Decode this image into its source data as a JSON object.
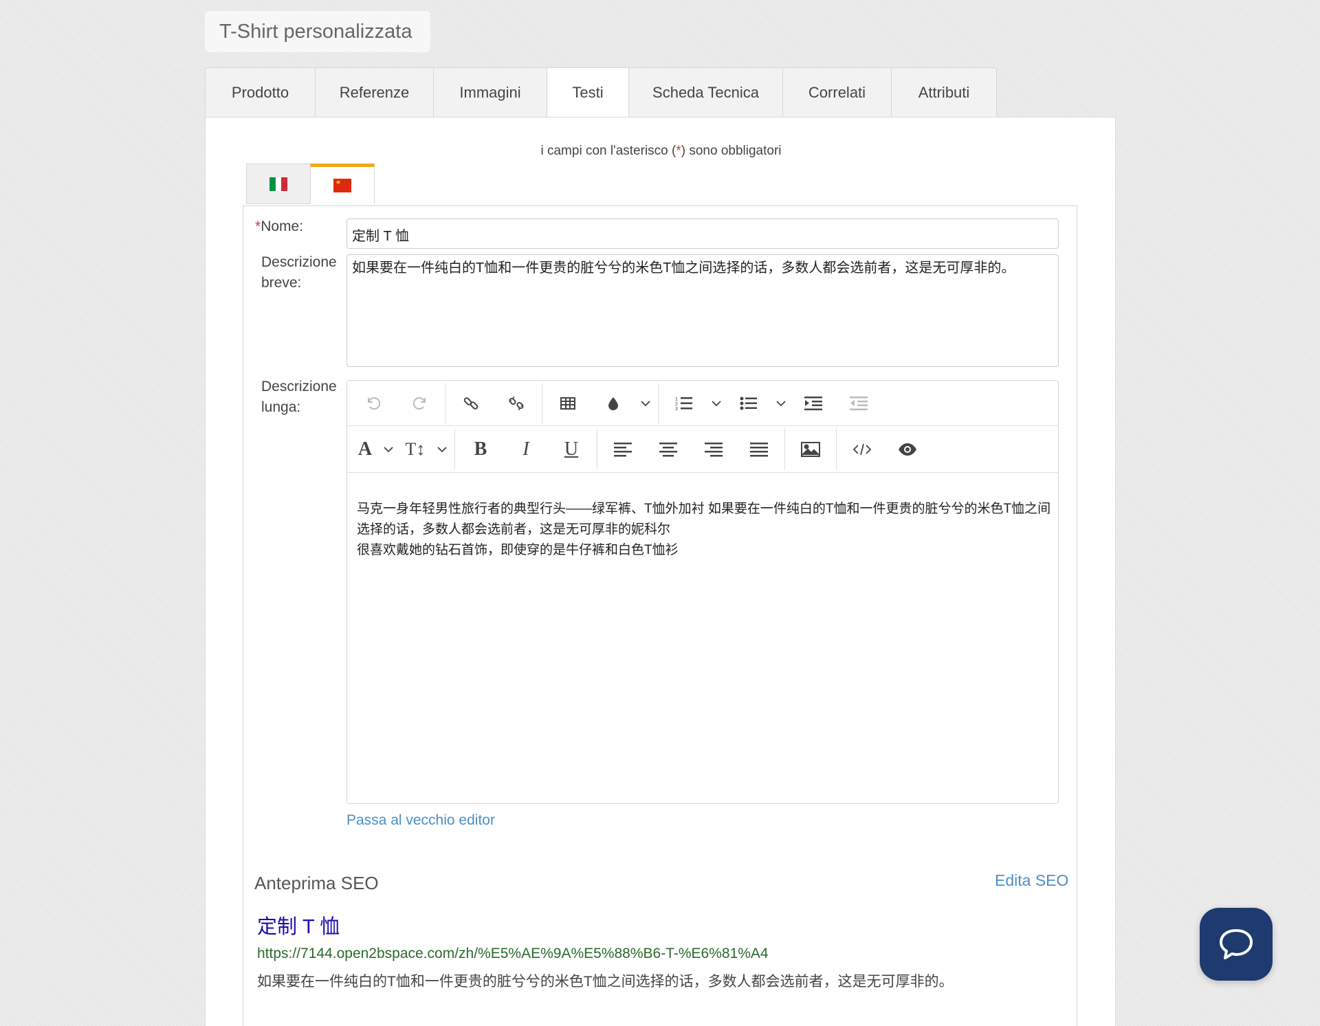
{
  "page_title": "T-Shirt personalizzata",
  "tabs": [
    {
      "label": "Prodotto",
      "width": 160
    },
    {
      "label": "Referenze",
      "width": 172
    },
    {
      "label": "Immagini",
      "width": 165
    },
    {
      "label": "Testi",
      "width": 119,
      "active": true
    },
    {
      "label": "Scheda Tecnica",
      "width": 224
    },
    {
      "label": "Correlati",
      "width": 158
    },
    {
      "label": "Attributi",
      "width": 154
    }
  ],
  "required_note": {
    "before": "i campi con l'asterisco (",
    "star": "*",
    "after": ") sono obbligatori"
  },
  "languages": [
    {
      "code": "it",
      "icon": "italy-flag-icon"
    },
    {
      "code": "zh",
      "icon": "china-flag-icon",
      "active": true
    }
  ],
  "form": {
    "name_label_star": "*",
    "name_label": "Nome:",
    "name_value": "定制 T 恤",
    "short_desc_label_1": "Descrizione",
    "short_desc_label_2": "breve:",
    "short_desc_value": "如果要在一件纯白的T恤和一件更贵的脏兮兮的米色T恤之间选择的话，多数人都会选前者，这是无可厚非的。",
    "long_desc_label_1": "Descrizione",
    "long_desc_label_2": "lunga:",
    "long_desc_line_1": "马克一身年轻男性旅行者的典型行头——绿军裤、T恤外加衬 如果要在一件纯白的T恤和一件更贵的脏兮兮的米色T恤之间选择的话，多数人都会选前者，这是无可厚非的妮科尔",
    "long_desc_line_2": "很喜欢戴她的钻石首饰，即使穿的是牛仔裤和白色T恤衫",
    "old_editor_link": "Passa al vecchio editor"
  },
  "toolbar": {
    "row1": [
      "undo-icon",
      "redo-icon",
      "link-icon",
      "unlink-icon",
      "table-icon",
      "color-drop-icon",
      "ordered-list-icon",
      "unordered-list-icon",
      "indent-icon",
      "outdent-icon"
    ],
    "row2": [
      "font-color-icon",
      "font-size-icon",
      "bold-icon",
      "italic-icon",
      "underline-icon",
      "align-left-icon",
      "align-center-icon",
      "align-right-icon",
      "align-justify-icon",
      "image-icon",
      "code-icon",
      "preview-eye-icon"
    ]
  },
  "seo": {
    "title": "Anteprima SEO",
    "edit_link": "Edita SEO",
    "name": "定制 T 恤",
    "url": "https://7144.open2bspace.com/zh/%E5%AE%9A%E5%88%B6-T-%E6%81%A4",
    "description": "如果要在一件纯白的T恤和一件更贵的脏兮兮的米色T恤之间选择的话，多数人都会选前者，这是无可厚非的。"
  },
  "chat": {
    "icon": "chat-bubble-icon"
  }
}
